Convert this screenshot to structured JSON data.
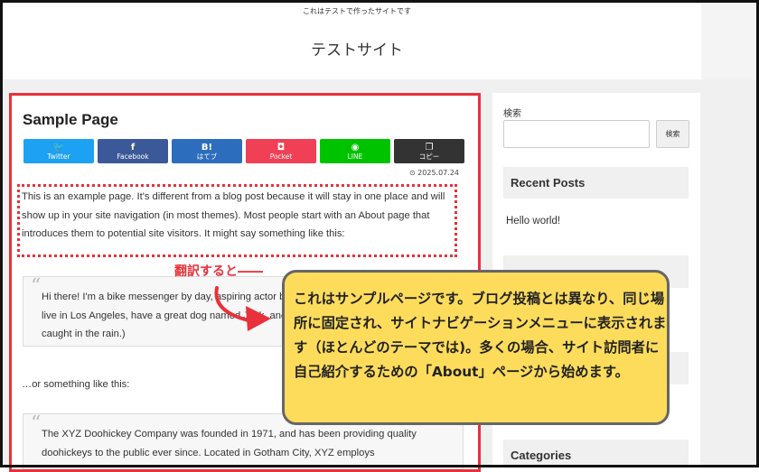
{
  "site": {
    "tagline": "これはテストで作ったサイトです",
    "title": "テストサイト"
  },
  "page": {
    "heading": "Sample Page",
    "date": "2025.07.24",
    "share_buttons": [
      {
        "name": "twitter",
        "icon": "twitter-bird-icon",
        "glyph": "🐦",
        "label": "Twitter",
        "color": "#1da1f2"
      },
      {
        "name": "facebook",
        "icon": "facebook-f-icon",
        "glyph": "f",
        "label": "Facebook",
        "color": "#3b5998"
      },
      {
        "name": "hatebu",
        "icon": "hatena-b-icon",
        "glyph": "B!",
        "label": "はてブ",
        "color": "#2c6ebd"
      },
      {
        "name": "pocket",
        "icon": "pocket-icon",
        "glyph": "◘",
        "label": "Pocket",
        "color": "#ef4056"
      },
      {
        "name": "line",
        "icon": "line-chat-icon",
        "glyph": "◉",
        "label": "LINE",
        "color": "#00c300"
      },
      {
        "name": "copy",
        "icon": "copy-icon",
        "glyph": "❐",
        "label": "コピー",
        "color": "#333333"
      }
    ],
    "intro": "This is an example page. It's different from a blog post because it will stay in one place and will show up in your site navigation (in most themes). Most people start with an About page that introduces them to potential site visitors. It might say something like this:",
    "quote1": "Hi there! I'm a bike messenger by day, aspiring actor by night, and this is my website. I live in Los Angeles, have a great dog named Jack, and I like piña coladas. (And gettin' caught in the rain.)",
    "middle": "…or something like this:",
    "quote2": "The XYZ Doohickey Company was founded in 1971, and has been providing quality doohickeys to the public ever since. Located in Gotham City, XYZ employs"
  },
  "sidebar": {
    "search_label": "検索",
    "search_button": "検索",
    "recent_posts_title": "Recent Posts",
    "recent_post": "Hello world!",
    "categories_title": "Categories"
  },
  "annotation": {
    "label": "翻訳すると――",
    "callout": "これはサンプルページです。ブログ投稿とは異なり、同じ場所に固定され、サイトナビゲーションメニューに表示されます（ほとんどのテーマでは)。多くの場合、サイト訪問者に自己紹介するための「About」ページから始めます。",
    "accent_color": "#e8313a",
    "callout_color": "#fddc5c"
  }
}
